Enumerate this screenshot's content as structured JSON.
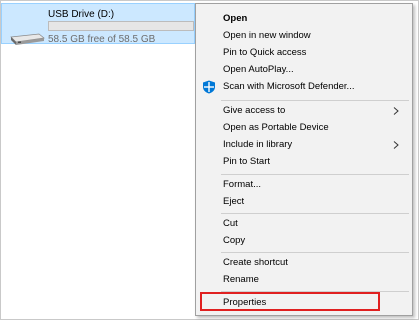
{
  "drive": {
    "name": "USB Drive (D:)",
    "free_text": "58.5 GB free of 58.5 GB",
    "used_fraction": 0.0,
    "icon": "usb-drive-icon"
  },
  "context_menu": {
    "items": [
      {
        "label": "Open",
        "bold": true
      },
      {
        "label": "Open in new window"
      },
      {
        "label": "Pin to Quick access"
      },
      {
        "label": "Open AutoPlay..."
      },
      {
        "label": "Scan with Microsoft Defender...",
        "icon": "defender-shield-icon"
      },
      {
        "label": "Give access to",
        "submenu": true
      },
      {
        "label": "Open as Portable Device"
      },
      {
        "label": "Include in library",
        "submenu": true
      },
      {
        "label": "Pin to Start"
      },
      {
        "label": "Format..."
      },
      {
        "label": "Eject"
      },
      {
        "label": "Cut"
      },
      {
        "label": "Copy"
      },
      {
        "label": "Create shortcut"
      },
      {
        "label": "Rename"
      },
      {
        "label": "Properties",
        "highlighted": true
      }
    ]
  },
  "colors": {
    "selection_bg": "#cce8ff",
    "highlight_border": "#e02020",
    "defender_blue": "#0078d7"
  }
}
